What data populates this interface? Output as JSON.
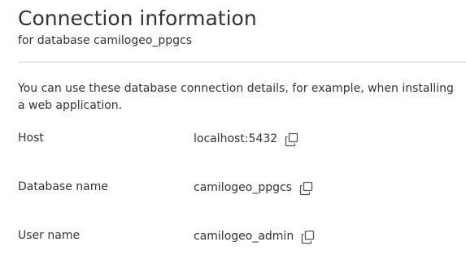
{
  "header": {
    "title": "Connection information",
    "subtitle": "for database camilogeo_ppgcs"
  },
  "description": "You can use these database connection details, for example, when installing a web application.",
  "rows": [
    {
      "label": "Host",
      "value": "localhost:5432",
      "icon": "copy-icon"
    },
    {
      "label": "Database name",
      "value": "camilogeo_ppgcs",
      "icon": "copy-icon"
    },
    {
      "label": "User name",
      "value": "camilogeo_admin",
      "icon": "copy-icon"
    }
  ],
  "colors": {
    "text": "#333333",
    "divider": "#d6d6d6",
    "icon": "#555555"
  }
}
